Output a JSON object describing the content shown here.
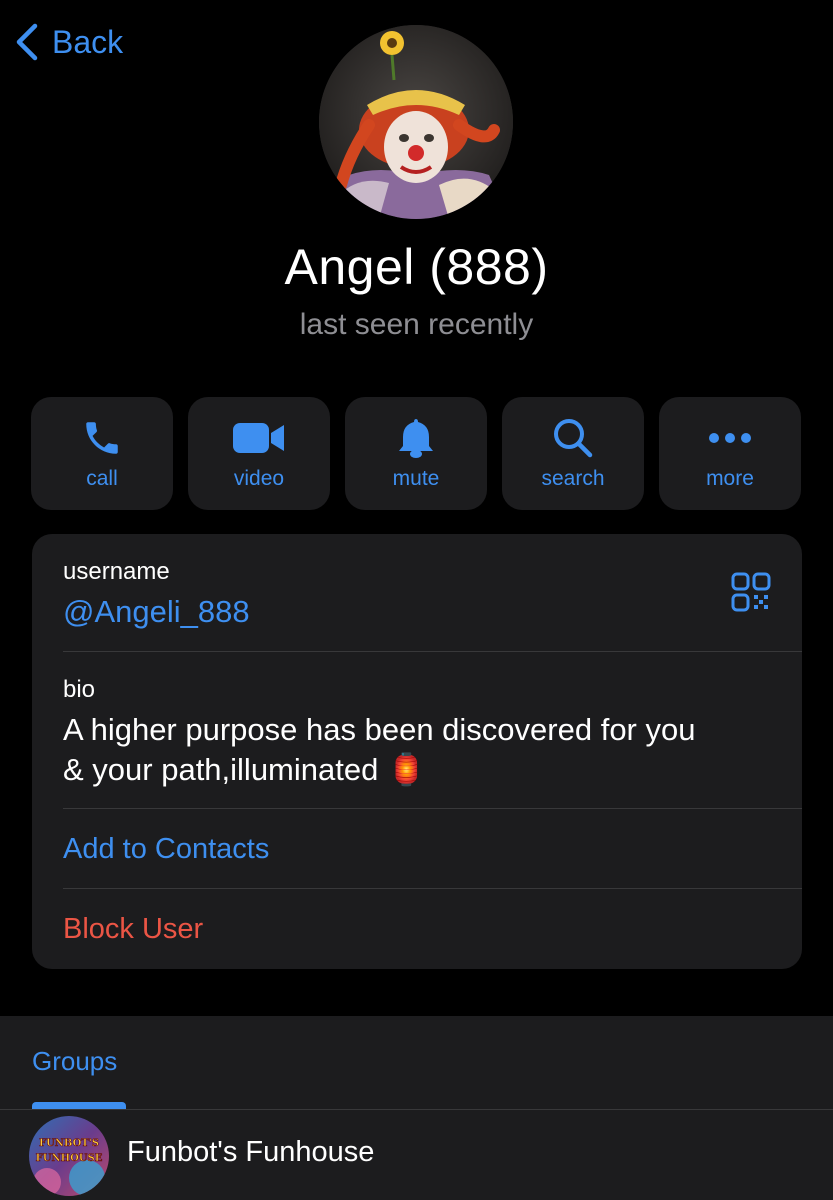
{
  "nav": {
    "back_label": "Back"
  },
  "profile": {
    "name": "Angel (888)",
    "status": "last seen recently"
  },
  "actions": [
    {
      "label": "call",
      "icon": "phone-icon"
    },
    {
      "label": "video",
      "icon": "video-camera-icon"
    },
    {
      "label": "mute",
      "icon": "bell-icon"
    },
    {
      "label": "search",
      "icon": "search-icon"
    },
    {
      "label": "more",
      "icon": "more-dots-icon"
    }
  ],
  "info": {
    "username_label": "username",
    "username_value": "@Angeli_888",
    "bio_label": "bio",
    "bio_line1": "A higher purpose has been discovered for you",
    "bio_line2": "& your path,illuminated 🏮",
    "add_contact": "Add to Contacts",
    "block_user": "Block User"
  },
  "groups": {
    "tab_label": "Groups",
    "items": [
      {
        "name": "Funbot's Funhouse",
        "logo_text_1": "FUNBOT'S",
        "logo_text_2": "FUNHOUSE"
      }
    ]
  },
  "colors": {
    "accent": "#3e8ff0",
    "danger": "#eb5545",
    "card": "#1c1c1e",
    "secondary_text": "#8e8e93"
  }
}
